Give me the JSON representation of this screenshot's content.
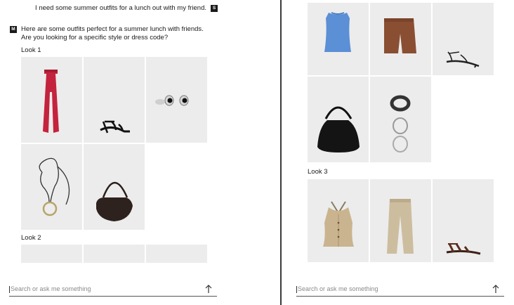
{
  "left": {
    "user_message": "I need some summer outfits for a lunch out with my friend.",
    "user_badge": "S",
    "assistant_badge": "M",
    "assistant_message": "Here are some outfits perfect for a summer lunch with friends. Are you looking for a specific style or dress code?",
    "look1_label": "Look 1",
    "look1_items": [
      "red-jumpsuit",
      "black-strappy-sandal",
      "silver-earrings",
      "cord-pendant-necklace",
      "brown-shoulder-bag"
    ],
    "look2_label": "Look 2",
    "search_placeholder": "Search or ask me something"
  },
  "right": {
    "look2_items": [
      "blue-sleeveless-top",
      "brown-bermuda-shorts",
      "black-kitten-heel-sandal",
      "black-hobo-bag",
      "silver-bangles"
    ],
    "look3_label": "Look 3",
    "look3_items": [
      "beige-halter-waistcoat",
      "beige-trousers",
      "brown-flat-sandal"
    ],
    "search_placeholder": "Search or ask me something"
  },
  "icons": {
    "send": "arrow-up-icon"
  },
  "colors": {
    "tile_bg": "#ececec",
    "badge_bg": "#1a1a1a",
    "divider": "#3a3a3a"
  }
}
